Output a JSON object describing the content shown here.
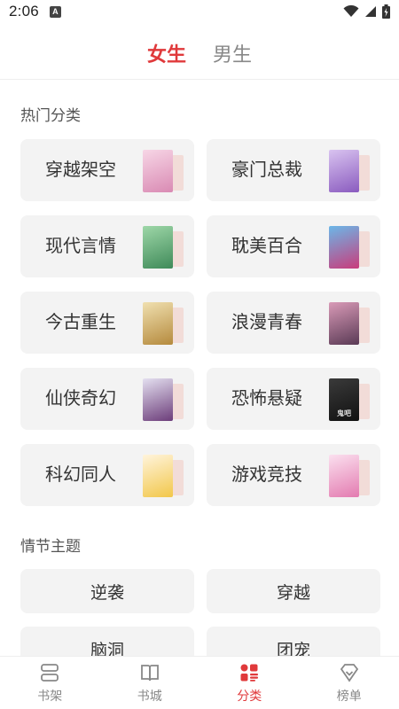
{
  "status": {
    "time": "2:06",
    "badge": "A"
  },
  "gender_tabs": [
    {
      "label": "女生",
      "active": true
    },
    {
      "label": "男生",
      "active": false
    }
  ],
  "sections": {
    "hot": "热门分类",
    "plot": "情节主题"
  },
  "categories": [
    {
      "label": "穿越架空",
      "cover_colors": [
        "#f7d6e6",
        "#d98ab3"
      ],
      "cover_text": ""
    },
    {
      "label": "豪门总裁",
      "cover_colors": [
        "#d9c3f0",
        "#8a5bbf"
      ],
      "cover_text": ""
    },
    {
      "label": "现代言情",
      "cover_colors": [
        "#9ed7a8",
        "#3f8a59"
      ],
      "cover_text": ""
    },
    {
      "label": "耽美百合",
      "cover_colors": [
        "#6bb7e8",
        "#c93c7b"
      ],
      "cover_text": ""
    },
    {
      "label": "今古重生",
      "cover_colors": [
        "#f0e0b0",
        "#b58a3d"
      ],
      "cover_text": ""
    },
    {
      "label": "浪漫青春",
      "cover_colors": [
        "#d99ab7",
        "#5a3a55"
      ],
      "cover_text": ""
    },
    {
      "label": "仙侠奇幻",
      "cover_colors": [
        "#e4e0f0",
        "#6c3d7a"
      ],
      "cover_text": ""
    },
    {
      "label": "恐怖悬疑",
      "cover_colors": [
        "#3a3a3a",
        "#111111"
      ],
      "cover_text": "鬼吧"
    },
    {
      "label": "科幻同人",
      "cover_colors": [
        "#fff4dc",
        "#f2c74a"
      ],
      "cover_text": ""
    },
    {
      "label": "游戏竞技",
      "cover_colors": [
        "#fbe0ef",
        "#e37bb0"
      ],
      "cover_text": ""
    }
  ],
  "themes": [
    {
      "label": "逆袭"
    },
    {
      "label": "穿越"
    },
    {
      "label": "脑洞"
    },
    {
      "label": "团宠"
    }
  ],
  "bottom_nav": [
    {
      "label": "书架",
      "icon": "bookshelf-icon",
      "active": false
    },
    {
      "label": "书城",
      "icon": "open-book-icon",
      "active": false
    },
    {
      "label": "分类",
      "icon": "category-grid-icon",
      "active": true
    },
    {
      "label": "榜单",
      "icon": "ranking-icon",
      "active": false
    }
  ],
  "colors": {
    "accent": "#e0393b",
    "card_bg": "#f3f3f3",
    "muted": "#888888"
  }
}
